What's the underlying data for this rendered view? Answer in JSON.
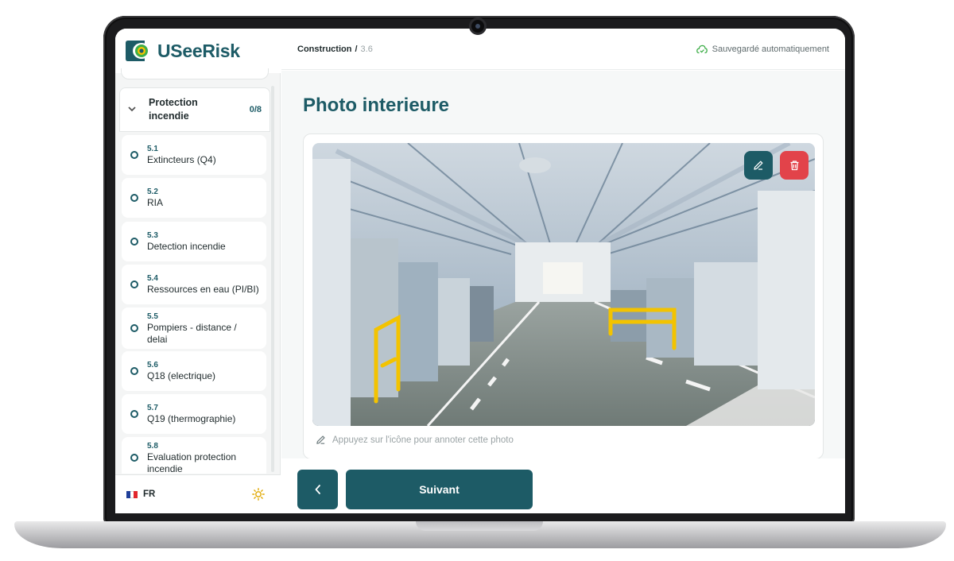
{
  "brand": {
    "name": "USeeRisk",
    "accent": "#1d5b66",
    "danger": "#e2434a"
  },
  "sidebar": {
    "section": {
      "title": "Protection incendie",
      "count": "0/8",
      "icon": "chevron-down-icon"
    },
    "items": [
      {
        "num": "5.1",
        "label": "Extincteurs (Q4)"
      },
      {
        "num": "5.2",
        "label": "RIA"
      },
      {
        "num": "5.3",
        "label": "Detection incendie"
      },
      {
        "num": "5.4",
        "label": "Ressources en eau (PI/BI)"
      },
      {
        "num": "5.5",
        "label": "Pompiers - distance / delai"
      },
      {
        "num": "5.6",
        "label": "Q18 (electrique)"
      },
      {
        "num": "5.7",
        "label": "Q19 (thermographie)"
      },
      {
        "num": "5.8",
        "label": "Evaluation protection incendie"
      }
    ],
    "footer": {
      "language": "FR",
      "theme_icon": "sun-icon"
    }
  },
  "header": {
    "breadcrumb": {
      "section": "Construction",
      "separator": "/",
      "step": "3.6"
    },
    "autosave": "Sauvegardé automatiquement"
  },
  "main": {
    "title": "Photo interieure",
    "photo_hint": "Appuyez sur l'icône pour annoter cette photo"
  },
  "footer_nav": {
    "next_label": "Suivant"
  }
}
